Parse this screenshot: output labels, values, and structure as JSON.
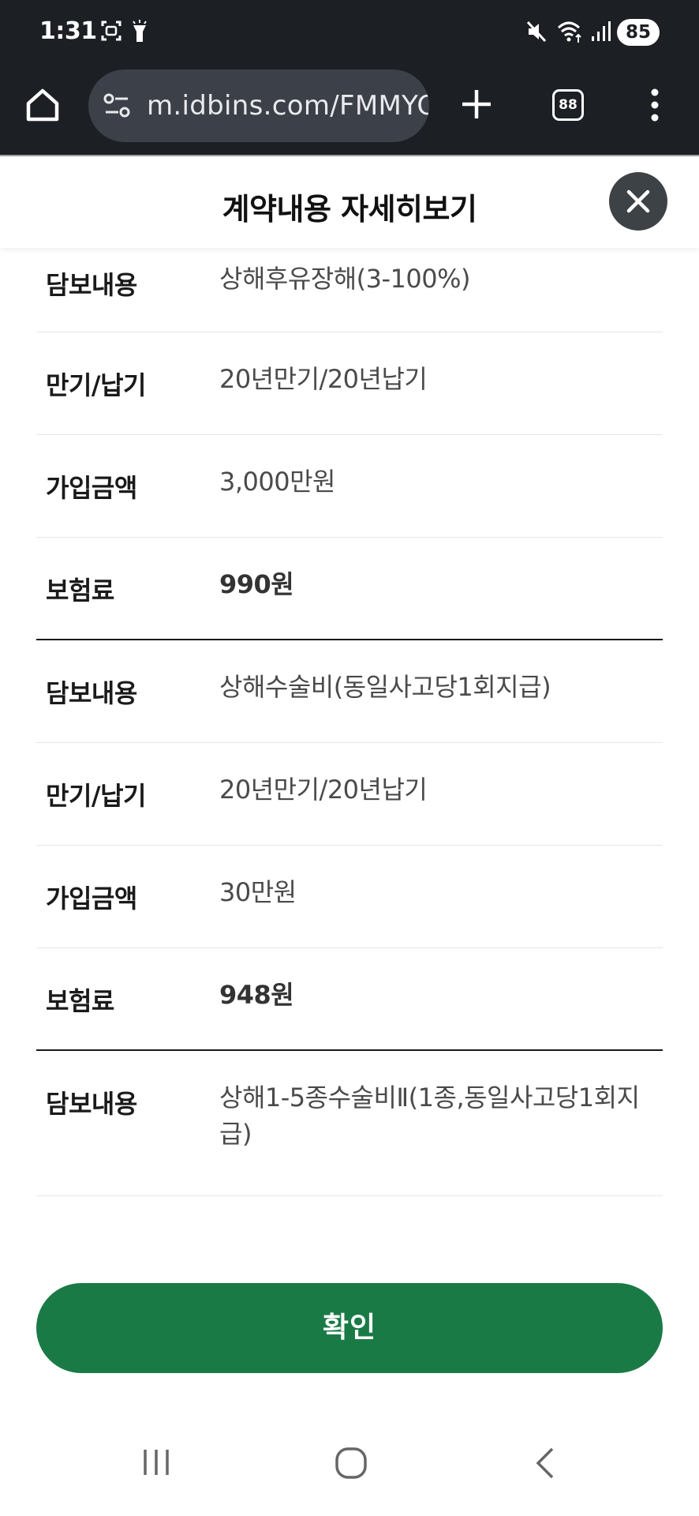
{
  "status_bar": {
    "time": "1:31",
    "battery": "85",
    "icons": [
      "screenshot-icon",
      "flashlight-icon",
      "mute-icon",
      "wifi-icon",
      "signal-icon",
      "battery-icon"
    ]
  },
  "browser": {
    "url": "m.idbins.com/FMMYC",
    "tab_count": "88",
    "icons": [
      "home-icon",
      "site-settings-icon",
      "new-tab-icon",
      "tabs-icon",
      "more-icon"
    ]
  },
  "header": {
    "title": "계약내용 자세히보기",
    "close_icon": "close-icon"
  },
  "rows": [
    {
      "label": "담보내용",
      "value": "상해후유장해(3-100%)"
    },
    {
      "label": "만기/납기",
      "value": "20년만기/20년납기"
    },
    {
      "label": "가입금액",
      "value": "3,000만원"
    },
    {
      "label": "보험료",
      "value": "990원"
    },
    {
      "label": "담보내용",
      "value": "상해수술비(동일사고당1회지급)"
    },
    {
      "label": "만기/납기",
      "value": "20년만기/20년납기"
    },
    {
      "label": "가입금액",
      "value": "30만원"
    },
    {
      "label": "보험료",
      "value": "948원"
    },
    {
      "label": "담보내용",
      "value": "상해1-5종수술비Ⅱ(1종,동일사고당1회지급)"
    }
  ],
  "confirm_label": "확인",
  "nav": {
    "icons": [
      "recent-apps-icon",
      "home-nav-icon",
      "back-icon"
    ]
  },
  "colors": {
    "system_bar": "#1c1f24",
    "url_pill": "#3c4048",
    "close_button": "#3d4247",
    "confirm_button": "#1a7a45",
    "divider": "#e6e6e6",
    "section_divider": "#1a1a1a"
  }
}
